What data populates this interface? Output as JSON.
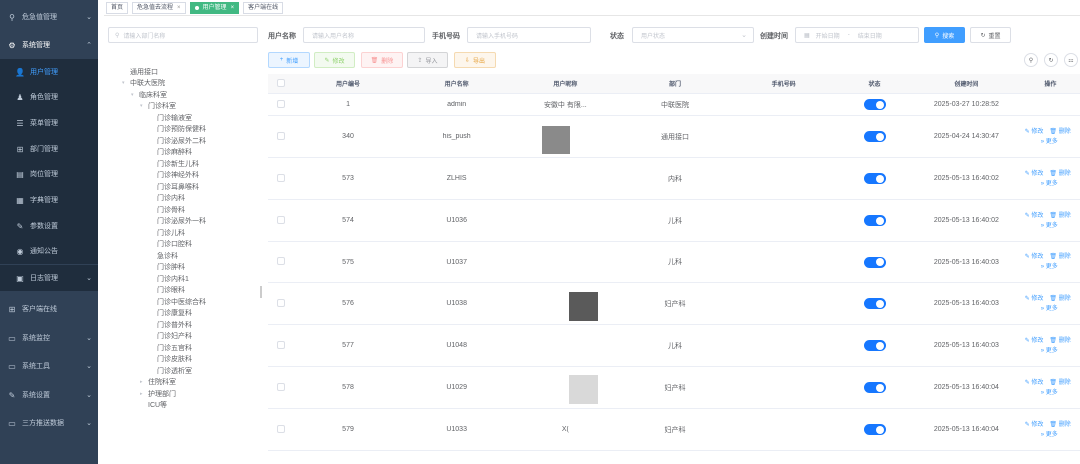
{
  "sidebar": {
    "items": [
      {
        "icon": "⚲",
        "label": "危急值管理",
        "arrow": "⌄",
        "type": "top"
      },
      {
        "icon": "⚙",
        "label": "系统管理",
        "arrow": "⌃",
        "type": "open"
      },
      {
        "icon": "👤",
        "label": "用户管理",
        "type": "sub",
        "active": true
      },
      {
        "icon": "♟",
        "label": "角色管理",
        "type": "sub"
      },
      {
        "icon": "☰",
        "label": "菜单管理",
        "type": "sub"
      },
      {
        "icon": "⊞",
        "label": "部门管理",
        "type": "sub"
      },
      {
        "icon": "▤",
        "label": "岗位管理",
        "type": "sub"
      },
      {
        "icon": "▦",
        "label": "字典管理",
        "type": "sub"
      },
      {
        "icon": "✎",
        "label": "参数设置",
        "type": "sub"
      },
      {
        "icon": "◉",
        "label": "通知公告",
        "type": "sub"
      },
      {
        "icon": "▣",
        "label": "日志管理",
        "arrow": "⌄",
        "type": "sub"
      },
      {
        "icon": "⊞",
        "label": "客户端在线",
        "type": "top"
      },
      {
        "icon": "▭",
        "label": "系统监控",
        "arrow": "⌄",
        "type": "top"
      },
      {
        "icon": "▭",
        "label": "系统工具",
        "arrow": "⌄",
        "type": "top"
      },
      {
        "icon": "✎",
        "label": "系统设置",
        "arrow": "⌄",
        "type": "top"
      },
      {
        "icon": "▭",
        "label": "三方推送数据",
        "arrow": "⌄",
        "type": "top"
      }
    ]
  },
  "tags": [
    {
      "label": "首页",
      "closable": false,
      "active": false
    },
    {
      "label": "危急值去流程",
      "closable": true,
      "active": false
    },
    {
      "label": "用户管理",
      "closable": true,
      "active": true
    },
    {
      "label": "客户端在线",
      "closable": false,
      "active": false
    }
  ],
  "tree": {
    "search_placeholder": "请输入部门名称",
    "nodes": [
      {
        "label": "通用接口",
        "indent": 0,
        "caret": ""
      },
      {
        "label": "中联大医院",
        "indent": 0,
        "caret": "▾"
      },
      {
        "label": "临床科室",
        "indent": 1,
        "caret": "▾"
      },
      {
        "label": "门诊科室",
        "indent": 2,
        "caret": "▾"
      },
      {
        "label": "门诊输液室",
        "indent": 3,
        "caret": ""
      },
      {
        "label": "门诊预防保健科",
        "indent": 3,
        "caret": ""
      },
      {
        "label": "门诊泌尿外二科",
        "indent": 3,
        "caret": ""
      },
      {
        "label": "门诊麻醉科",
        "indent": 3,
        "caret": ""
      },
      {
        "label": "门诊新生儿科",
        "indent": 3,
        "caret": ""
      },
      {
        "label": "门诊神经外科",
        "indent": 3,
        "caret": ""
      },
      {
        "label": "门诊耳鼻喉科",
        "indent": 3,
        "caret": ""
      },
      {
        "label": "门诊内科",
        "indent": 3,
        "caret": ""
      },
      {
        "label": "门诊骨科",
        "indent": 3,
        "caret": ""
      },
      {
        "label": "门诊泌尿外一科",
        "indent": 3,
        "caret": ""
      },
      {
        "label": "门诊儿科",
        "indent": 3,
        "caret": ""
      },
      {
        "label": "门诊口腔科",
        "indent": 3,
        "caret": ""
      },
      {
        "label": "急诊科",
        "indent": 3,
        "caret": ""
      },
      {
        "label": "门诊肿科",
        "indent": 3,
        "caret": ""
      },
      {
        "label": "门诊内科1",
        "indent": 3,
        "caret": ""
      },
      {
        "label": "门诊眼科",
        "indent": 3,
        "caret": ""
      },
      {
        "label": "门诊中医综合科",
        "indent": 3,
        "caret": ""
      },
      {
        "label": "门诊康复科",
        "indent": 3,
        "caret": ""
      },
      {
        "label": "门诊普外科",
        "indent": 3,
        "caret": ""
      },
      {
        "label": "门诊妇产科",
        "indent": 3,
        "caret": ""
      },
      {
        "label": "门诊五官科",
        "indent": 3,
        "caret": ""
      },
      {
        "label": "门诊皮肤科",
        "indent": 3,
        "caret": ""
      },
      {
        "label": "门诊透析室",
        "indent": 3,
        "caret": ""
      },
      {
        "label": "住院科室",
        "indent": 2,
        "caret": "▸"
      },
      {
        "label": "护理部门",
        "indent": 2,
        "caret": "▸"
      },
      {
        "label": "ICU等",
        "indent": 2,
        "caret": ""
      }
    ]
  },
  "query": {
    "username_label": "用户名称",
    "username_placeholder": "请输入用户名称",
    "phone_label": "手机号码",
    "phone_placeholder": "请输入手机号码",
    "status_label": "状态",
    "status_placeholder": "用户状态",
    "created_label": "创建时间",
    "start_placeholder": "开始日期",
    "date_sep": "-",
    "end_placeholder": "结束日期",
    "search_btn": "搜索",
    "reset_btn": "重置"
  },
  "toolbar": {
    "add": "新增",
    "edit": "修改",
    "delete": "删除",
    "import": "导入",
    "export": "导出"
  },
  "table": {
    "headers": {
      "id": "用户编号",
      "name": "用户名称",
      "nick": "用户昵称",
      "dept": "部门",
      "phone": "手机号码",
      "status": "状态",
      "time": "创建时间",
      "op": "操作"
    },
    "op_edit": "修改",
    "op_delete": "删除",
    "op_more": "更多",
    "rows": [
      {
        "id": "1",
        "name": "admin",
        "nick": "安徽中      有限...",
        "dept": "中联医院",
        "time": "2025-03-27 10:28:52",
        "ops": false
      },
      {
        "id": "340",
        "name": "his_push",
        "nick": "",
        "dept": "通用接口",
        "time": "2025-04-24 14:30:47",
        "ops": true
      },
      {
        "id": "573",
        "name": "ZLHIS",
        "nick": "",
        "dept": "内科",
        "time": "2025-05-13 16:40:02",
        "ops": true
      },
      {
        "id": "574",
        "name": "U1036",
        "nick": "",
        "dept": "儿科",
        "time": "2025-05-13 16:40:02",
        "ops": true
      },
      {
        "id": "575",
        "name": "U1037",
        "nick": "",
        "dept": "儿科",
        "time": "2025-05-13 16:40:03",
        "ops": true
      },
      {
        "id": "576",
        "name": "U1038",
        "nick": "",
        "dept": "妇产科",
        "time": "2025-05-13 16:40:03",
        "ops": true
      },
      {
        "id": "577",
        "name": "U1048",
        "nick": "",
        "dept": "儿科",
        "time": "2025-05-13 16:40:03",
        "ops": true
      },
      {
        "id": "578",
        "name": "U1029",
        "nick": "",
        "dept": "妇产科",
        "time": "2025-05-13 16:40:04",
        "ops": true
      },
      {
        "id": "579",
        "name": "U1033",
        "nick": "X(",
        "dept": "妇产科",
        "time": "2025-05-13 16:40:04",
        "ops": true
      }
    ]
  },
  "colors": {
    "sidebar_bg": "#304156",
    "accent": "#409eff",
    "switch_on": "#1677ff",
    "tag_active": "#42b983"
  },
  "icons": {
    "search": "⚲",
    "refresh": "↻",
    "columns": "⚏",
    "calendar": "▦",
    "chevron": "⌄"
  }
}
